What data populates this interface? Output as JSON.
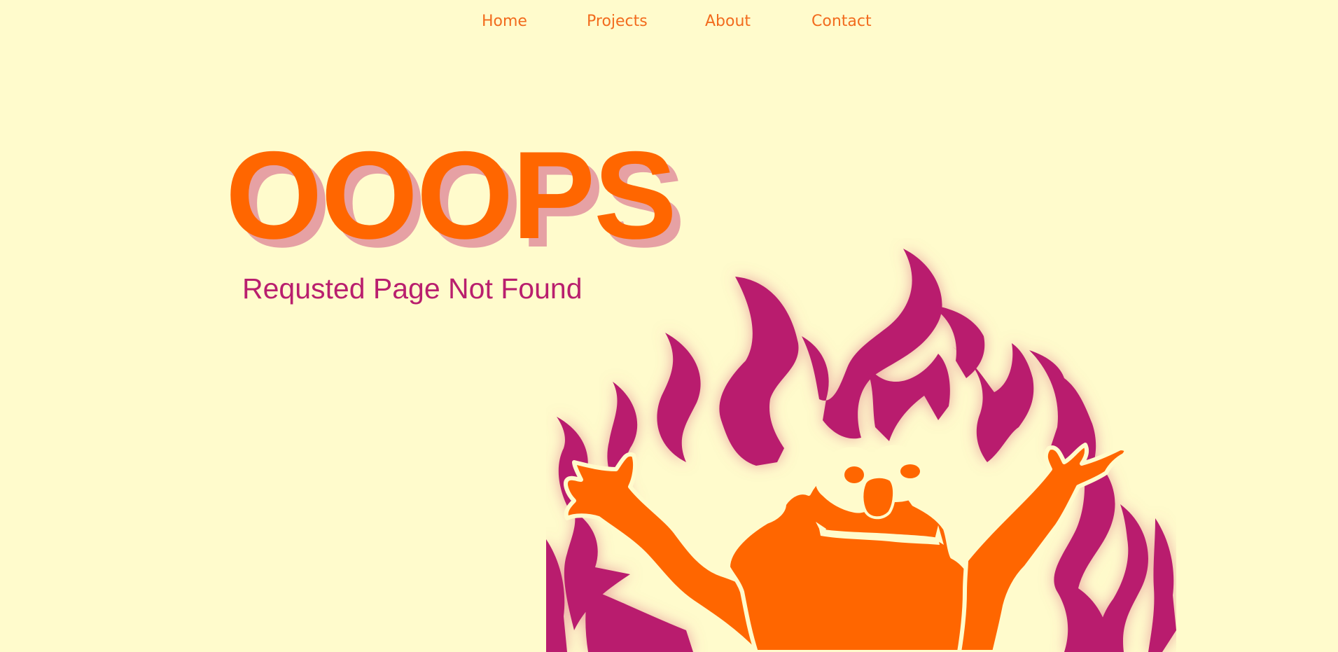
{
  "nav": {
    "items": [
      {
        "label": "Home"
      },
      {
        "label": "Projects"
      },
      {
        "label": "About"
      },
      {
        "label": "Contact"
      }
    ]
  },
  "hero": {
    "title": "OOOPS",
    "subtitle": "Requsted Page Not Found"
  },
  "illustration": {
    "icon": "fire-monster-illustration"
  },
  "colors": {
    "background": "#fffbcc",
    "accent_orange": "#ff6600",
    "nav_orange": "#f26b1d",
    "title_shadow": "#e6a1a4",
    "magenta": "#b91f6e"
  }
}
